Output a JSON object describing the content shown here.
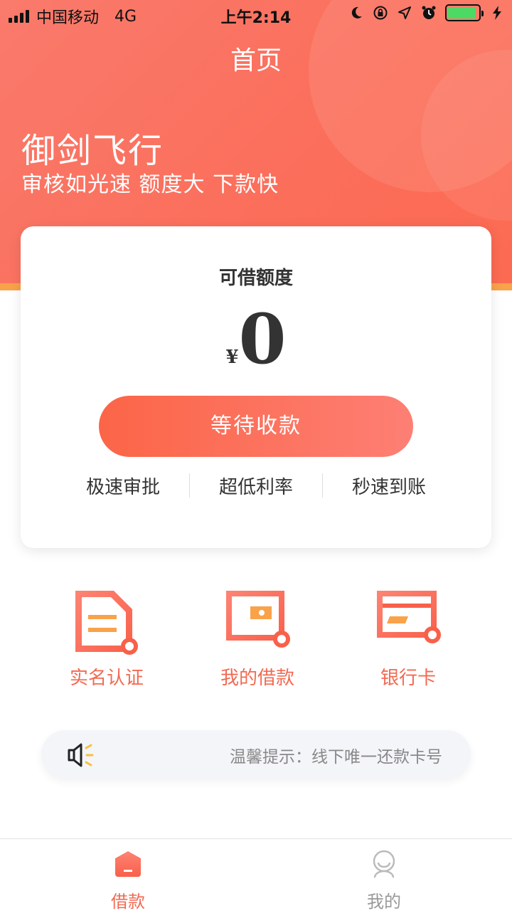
{
  "status_bar": {
    "carrier": "中国移动",
    "network": "4G",
    "time": "上午2:14",
    "battery_color": "#4cd964"
  },
  "header": {
    "title": "首页"
  },
  "hero": {
    "title": "御剑飞行",
    "subtitle": "审核如光速 额度大 下款快"
  },
  "credit_card": {
    "label": "可借额度",
    "currency": "¥",
    "amount": "0",
    "button_label": "等待收款",
    "features": [
      "极速审批",
      "超低利率",
      "秒速到账"
    ]
  },
  "quick_actions": [
    {
      "label": "实名认证",
      "icon": "id-document-icon"
    },
    {
      "label": "我的借款",
      "icon": "wallet-icon"
    },
    {
      "label": "银行卡",
      "icon": "bank-card-icon"
    }
  ],
  "notice": {
    "icon": "speaker-icon",
    "text": "温馨提示：线下唯一还款卡号"
  },
  "tabbar": {
    "items": [
      {
        "label": "借款",
        "icon": "home-icon",
        "active": true
      },
      {
        "label": "我的",
        "icon": "profile-icon",
        "active": false
      }
    ]
  },
  "colors": {
    "accent": "#f26a52",
    "hero_start": "#fa7a6c",
    "button_start": "#fc6547",
    "button_end": "#fd7f74",
    "stripe": "#f9a24a"
  }
}
